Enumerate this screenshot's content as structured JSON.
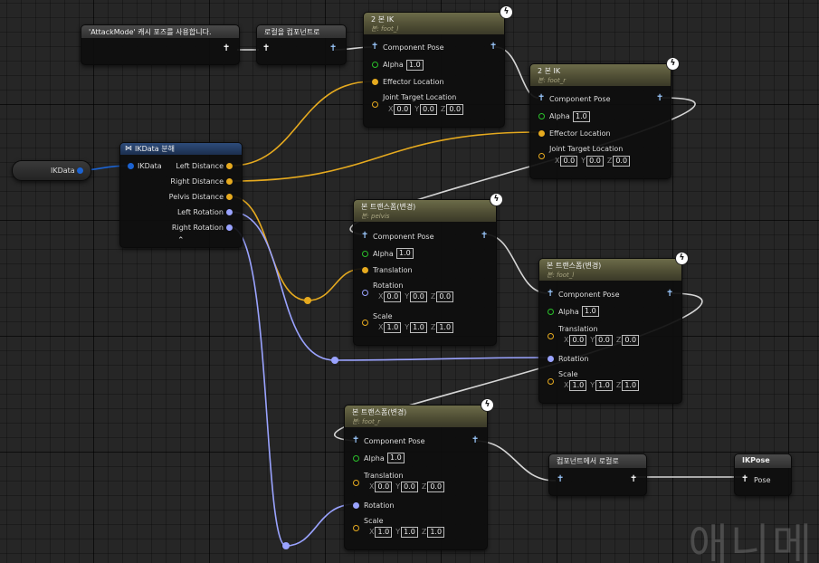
{
  "colors": {
    "exec_pose": "#9cc9ff",
    "vector": "#e6aa1f",
    "float_alpha": "#2ac12a",
    "struct": "#1b63d2",
    "rotator": "#9aa3ff"
  },
  "nodes": {
    "use_cached_pose": {
      "title": "'AttackMode' 캐시 포즈를 사용합니다."
    },
    "local_to_component": {
      "title": "로컬을 컴포넌트로"
    },
    "two_bone_ik_left": {
      "title": "2 본 IK",
      "subtitle": "본: foot_l",
      "component_pose": "Component Pose",
      "alpha_label": "Alpha",
      "alpha_value": "1.0",
      "effector_location": "Effector Location",
      "joint_target": "Joint Target Location",
      "x_label": "X",
      "y_label": "Y",
      "z_label": "Z",
      "x": "0.0",
      "y": "0.0",
      "z": "0.0"
    },
    "two_bone_ik_right": {
      "title": "2 본 IK",
      "subtitle": "본: foot_r",
      "component_pose": "Component Pose",
      "alpha_label": "Alpha",
      "alpha_value": "1.0",
      "effector_location": "Effector Location",
      "joint_target": "Joint Target Location",
      "x_label": "X",
      "y_label": "Y",
      "z_label": "Z",
      "x": "0.0",
      "y": "0.0",
      "z": "0.0"
    },
    "ikdata_var": {
      "label": "IKData"
    },
    "break_ikdata": {
      "title": "IKData 분해",
      "input": "IKData",
      "outputs": [
        "Left Distance",
        "Right Distance",
        "Pelvis Distance",
        "Left Rotation",
        "Right Rotation"
      ]
    },
    "transform_pelvis": {
      "title": "본 트랜스폼(변경)",
      "subtitle": "본: pelvis",
      "component_pose": "Component Pose",
      "alpha_label": "Alpha",
      "alpha_value": "1.0",
      "translation": "Translation",
      "rotation": "Rotation",
      "scale": "Scale",
      "x_label": "X",
      "y_label": "Y",
      "z_label": "Z",
      "rot": [
        "0.0",
        "0.0",
        "0.0"
      ],
      "scl": [
        "1.0",
        "1.0",
        "1.0"
      ]
    },
    "transform_foot_l": {
      "title": "본 트랜스폼(변경)",
      "subtitle": "본: foot_l",
      "component_pose": "Component Pose",
      "alpha_label": "Alpha",
      "alpha_value": "1.0",
      "translation": "Translation",
      "rotation": "Rotation",
      "scale": "Scale",
      "x_label": "X",
      "y_label": "Y",
      "z_label": "Z",
      "trn": [
        "0.0",
        "0.0",
        "0.0"
      ],
      "scl": [
        "1.0",
        "1.0",
        "1.0"
      ]
    },
    "transform_foot_r": {
      "title": "본 트랜스폼(변경)",
      "subtitle": "본: foot_r",
      "component_pose": "Component Pose",
      "alpha_label": "Alpha",
      "alpha_value": "1.0",
      "translation": "Translation",
      "rotation": "Rotation",
      "scale": "Scale",
      "x_label": "X",
      "y_label": "Y",
      "z_label": "Z",
      "trn": [
        "0.0",
        "0.0",
        "0.0"
      ],
      "scl": [
        "1.0",
        "1.0",
        "1.0"
      ]
    },
    "component_to_local": {
      "title": "컴포넌트에서 로컬로"
    },
    "output_pose": {
      "title": "IKPose",
      "pin": "Pose"
    }
  },
  "watermark": "애니메"
}
